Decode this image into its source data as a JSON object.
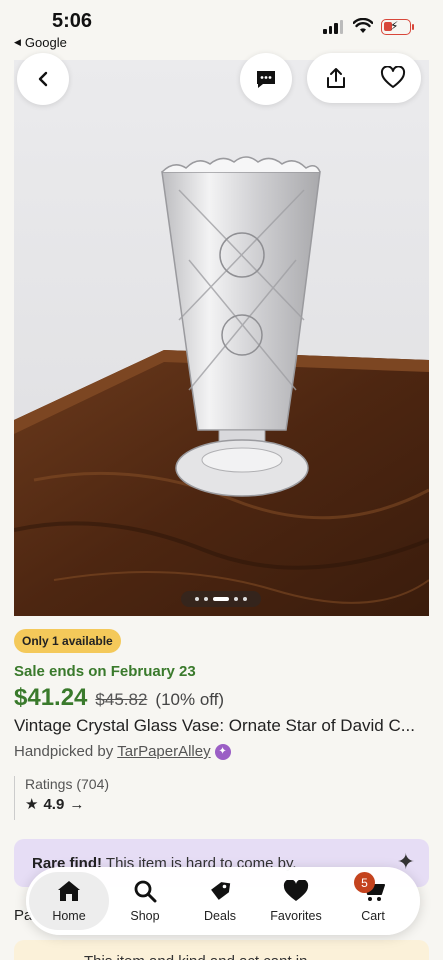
{
  "status_bar": {
    "time": "5:06",
    "back_app_label": "Google",
    "back_icon": "triangle-left-icon",
    "battery_color": "#d8473a"
  },
  "product_image": {
    "alt_description": "",
    "carousel_count": 5,
    "carousel_active_index": 2
  },
  "top_actions": {
    "back_icon": "chevron-left-icon",
    "message_icon": "chat-dots-icon",
    "share_icon": "share-icon",
    "favorite_icon": "heart-outline-icon"
  },
  "listing": {
    "availability_badge": "Only 1 available",
    "sale_text": "Sale ends on February 23",
    "price": "$41.24",
    "original_price": "$45.82",
    "discount": "(10% off)",
    "title": "Vintage Crystal Glass Vase: Ornate Star of David C...",
    "handpicked_prefix": "Handpicked by",
    "shop_name": "TarPaperAlley"
  },
  "ratings": {
    "label": "Ratings (704)",
    "value": "4.9",
    "arrow": "→"
  },
  "rare_find": {
    "bold": "Rare find!",
    "text": "This item is hard to come by."
  },
  "partial_section_label": "Pa",
  "bottom_card_text": "This item and  kind  and  act  cant  in",
  "tab_bar": {
    "tabs": [
      {
        "label": "Home",
        "icon": "home-icon",
        "active": true
      },
      {
        "label": "Shop",
        "icon": "search-icon"
      },
      {
        "label": "Deals",
        "icon": "tag-icon"
      },
      {
        "label": "Favorites",
        "icon": "heart-icon"
      },
      {
        "label": "Cart",
        "icon": "cart-icon"
      }
    ],
    "cart_count": "5"
  },
  "colors": {
    "sale_green": "#3a7a2c",
    "badge_yellow": "#f4c95a",
    "rare_purple": "#e6ddf5",
    "cart_badge": "#c4431e"
  }
}
